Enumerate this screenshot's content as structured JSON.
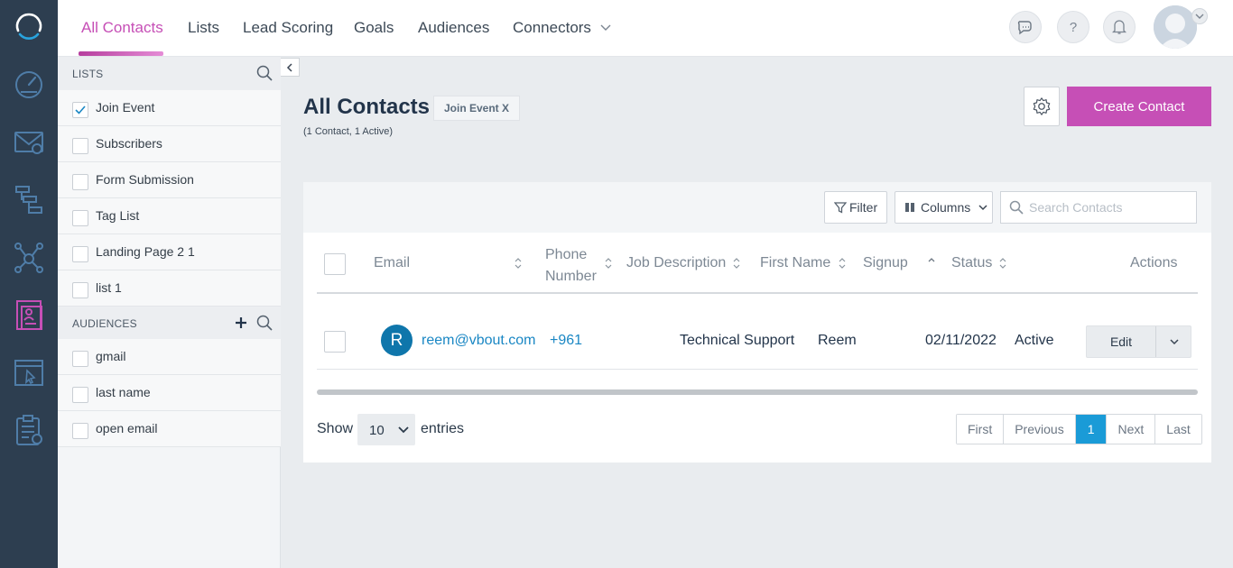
{
  "nav": {
    "items": [
      {
        "label": "All Contacts"
      },
      {
        "label": "Lists"
      },
      {
        "label": "Lead Scoring"
      },
      {
        "label": "Goals"
      },
      {
        "label": "Audiences"
      },
      {
        "label": "Connectors"
      }
    ],
    "active": "All Contacts"
  },
  "sidebar": {
    "rail_icons": [
      "logo-icon",
      "dashboard-icon",
      "email-icon",
      "workflow-icon",
      "social-network-icon",
      "contacts-icon",
      "landing-page-icon",
      "survey-icon"
    ]
  },
  "lists_panel": {
    "lists_heading": "LISTS",
    "lists": [
      {
        "label": "Join Event",
        "checked": true
      },
      {
        "label": "Subscribers",
        "checked": false
      },
      {
        "label": "Form Submission",
        "checked": false
      },
      {
        "label": "Tag List",
        "checked": false
      },
      {
        "label": "Landing Page 2 1",
        "checked": false
      },
      {
        "label": "list 1",
        "checked": false
      }
    ],
    "audiences_heading": "AUDIENCES",
    "audiences": [
      {
        "label": "gmail"
      },
      {
        "label": "last name"
      },
      {
        "label": "open email"
      }
    ]
  },
  "header": {
    "title": "All Contacts",
    "filter_tag": "Join Event X",
    "subtitle": "(1 Contact, 1 Active)",
    "create_label": "Create Contact"
  },
  "table": {
    "filter_label": "Filter",
    "columns_label": "Columns",
    "search_placeholder": "Search Contacts",
    "columns": [
      "Email",
      "Phone Number",
      "Job Description",
      "First Name",
      "Signup",
      "Status",
      "Actions"
    ],
    "rows": [
      {
        "avatar": "R",
        "email": "reem@vbout.com",
        "phone": "+961",
        "job": "Technical Support",
        "first_name": "Reem",
        "signup": "02/11/2022",
        "status": "Active",
        "action": "Edit"
      }
    ],
    "show_label": "Show",
    "entries_value": "10",
    "entries_label": "entries",
    "pager": [
      "First",
      "Previous",
      "1",
      "Next",
      "Last"
    ],
    "current_page": "1"
  },
  "colors": {
    "accent": "#c64fb6",
    "rail": "#2d3e50",
    "link": "#1a87c4",
    "pager_active": "#1a9bd7"
  }
}
